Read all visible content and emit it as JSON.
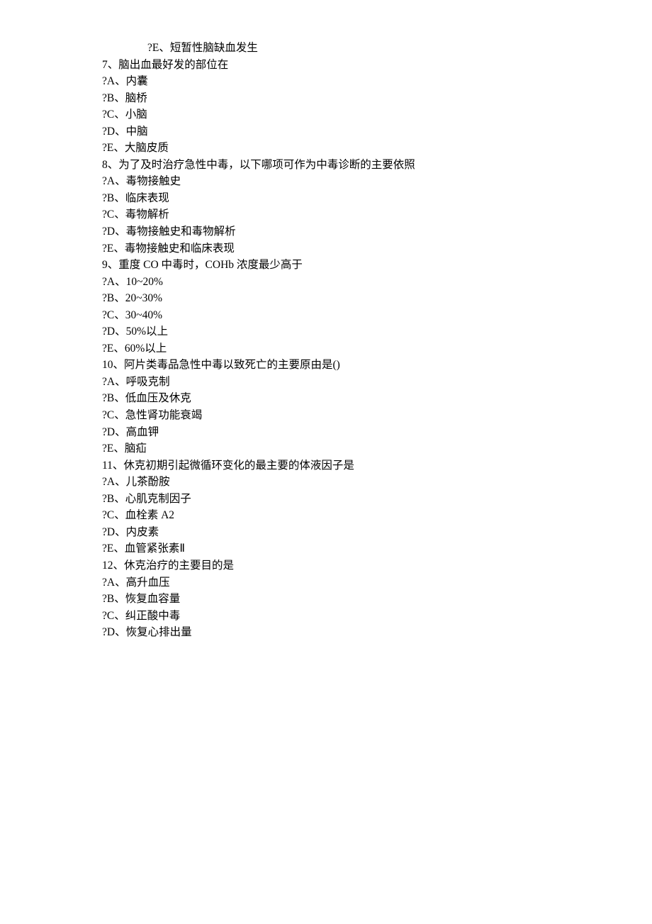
{
  "lines": [
    {
      "indent": true,
      "text": "?E、短暂性脑缺血发生"
    },
    {
      "indent": false,
      "text": "7、脑出血最好发的部位在"
    },
    {
      "indent": false,
      "text": "?A、内囊"
    },
    {
      "indent": false,
      "text": "?B、脑桥"
    },
    {
      "indent": false,
      "text": "?C、小脑"
    },
    {
      "indent": false,
      "text": "?D、中脑"
    },
    {
      "indent": false,
      "text": "?E、大脑皮质"
    },
    {
      "indent": false,
      "text": "8、为了及时治疗急性中毒，以下哪项可作为中毒诊断的主要依照"
    },
    {
      "indent": false,
      "text": "?A、毒物接触史"
    },
    {
      "indent": false,
      "text": "?B、临床表现"
    },
    {
      "indent": false,
      "text": "?C、毒物解析"
    },
    {
      "indent": false,
      "text": "?D、毒物接触史和毒物解析"
    },
    {
      "indent": false,
      "text": "?E、毒物接触史和临床表现"
    },
    {
      "indent": false,
      "text": "9、重度 CO 中毒时，COHb 浓度最少高于"
    },
    {
      "indent": false,
      "text": "?A、10~20%"
    },
    {
      "indent": false,
      "text": "?B、20~30%"
    },
    {
      "indent": false,
      "text": "?C、30~40%"
    },
    {
      "indent": false,
      "text": "?D、50%以上"
    },
    {
      "indent": false,
      "text": "?E、60%以上"
    },
    {
      "indent": false,
      "text": "10、阿片类毒品急性中毒以致死亡的主要原由是()"
    },
    {
      "indent": false,
      "text": "?A、呼吸克制"
    },
    {
      "indent": false,
      "text": "?B、低血压及休克"
    },
    {
      "indent": false,
      "text": "?C、急性肾功能衰竭"
    },
    {
      "indent": false,
      "text": "?D、高血钾"
    },
    {
      "indent": false,
      "text": "?E、脑疝"
    },
    {
      "indent": false,
      "text": "11、休克初期引起微循环变化的最主要的体液因子是"
    },
    {
      "indent": false,
      "text": "?A、儿茶酚胺"
    },
    {
      "indent": false,
      "text": "?B、心肌克制因子"
    },
    {
      "indent": false,
      "text": "?C、血栓素 A2"
    },
    {
      "indent": false,
      "text": "?D、内皮素"
    },
    {
      "indent": false,
      "text": "?E、血管紧张素Ⅱ"
    },
    {
      "indent": false,
      "text": "12、休克治疗的主要目的是"
    },
    {
      "indent": false,
      "text": "?A、高升血压"
    },
    {
      "indent": false,
      "text": "?B、恢复血容量"
    },
    {
      "indent": false,
      "text": "?C、纠正酸中毒"
    },
    {
      "indent": false,
      "text": "?D、恢复心排出量"
    }
  ]
}
